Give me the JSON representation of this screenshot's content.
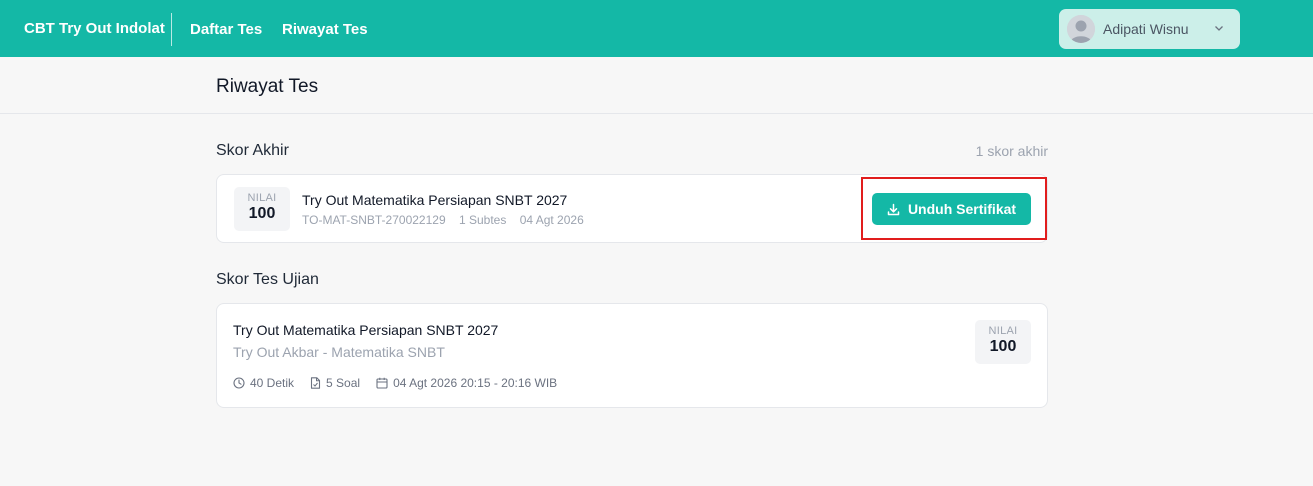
{
  "nav": {
    "brand": "CBT Try Out Indolat",
    "links": [
      "Daftar Tes",
      "Riwayat Tes"
    ],
    "user_name": "Adipati Wisnu"
  },
  "page": {
    "title": "Riwayat Tes"
  },
  "skor_akhir": {
    "title": "Skor Akhir",
    "count_label": "1 skor akhir",
    "item": {
      "score_label": "NILAI",
      "score_value": "100",
      "title": "Try Out Matematika Persiapan SNBT 2027",
      "code": "TO-MAT-SNBT-270022129",
      "subtests": "1 Subtes",
      "date": "04 Agt 2026",
      "download_label": "Unduh Sertifikat"
    }
  },
  "skor_tes": {
    "title": "Skor Tes Ujian",
    "item": {
      "title": "Try Out Matematika Persiapan SNBT 2027",
      "subtitle": "Try Out Akbar - Matematika SNBT",
      "duration": "40 Detik",
      "questions": "5 Soal",
      "datetime": "04 Agt 2026 20:15 - 20:16 WIB",
      "score_label": "NILAI",
      "score_value": "100"
    }
  },
  "colors": {
    "primary": "#14b8a6",
    "highlight": "#e11d1d"
  }
}
